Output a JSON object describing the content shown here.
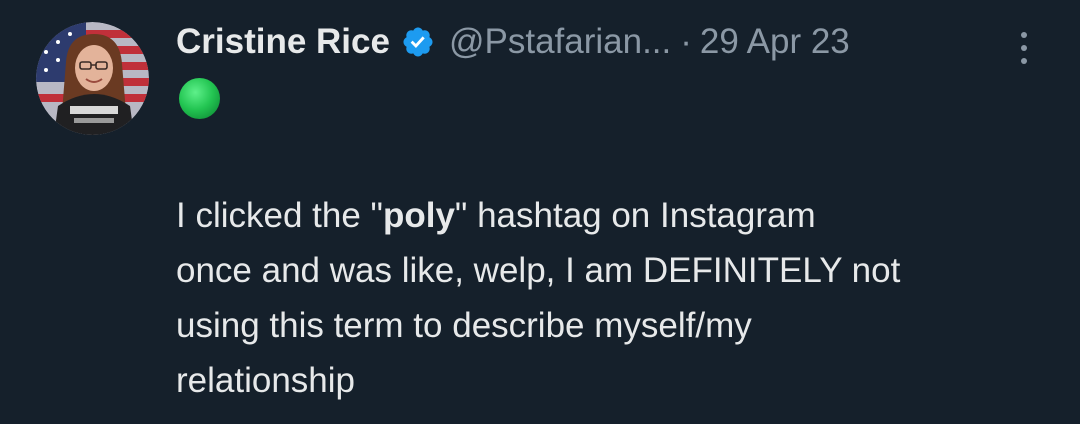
{
  "tweet": {
    "author": {
      "display_name": "Cristine Rice",
      "handle": "@Pstafarian...",
      "verified": true,
      "avatar_desc": "avatar"
    },
    "separator": "·",
    "date": "29 Apr 23",
    "status_emoji": "green-circle",
    "body": {
      "line1_pre": "I clicked the \"",
      "line1_bold": "poly",
      "line1_post": "\" hashtag on Instagram",
      "line2": "once and was like, welp, I am DEFINITELY not",
      "line3": "using this term to describe myself/my",
      "line4": "relationship"
    }
  },
  "colors": {
    "background": "#15202b",
    "primary_text": "#e7e9ea",
    "secondary_text": "#8b98a5",
    "verified_blue": "#1d9bf0",
    "status_green": "#2fd35a"
  },
  "icons": {
    "verified": "verified-badge-icon",
    "more": "more-vertical-icon",
    "status": "green-circle-icon"
  }
}
